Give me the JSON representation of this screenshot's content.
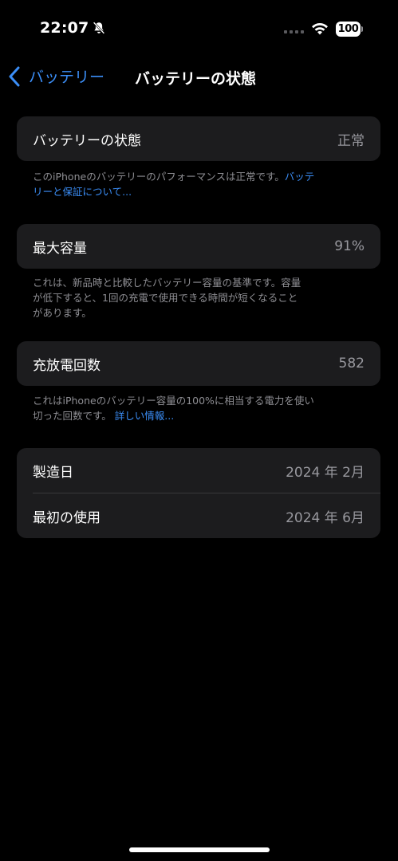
{
  "status_bar": {
    "time": "22:07",
    "battery_level": "100",
    "icons": [
      "bell-slash-icon",
      "signal-icon",
      "wifi-icon",
      "battery-icon"
    ]
  },
  "nav": {
    "back_label": "バッテリー",
    "title": "バッテリーの状態"
  },
  "health": {
    "label": "バッテリーの状態",
    "value": "正常",
    "footer_text": "このiPhoneのバッテリーのパフォーマンスは正常です。",
    "footer_link_part1": "バッテ",
    "footer_link_part2": "リーと保証について..."
  },
  "capacity": {
    "label": "最大容量",
    "value": "91%",
    "footer_line1": "これは、新品時と比較したバッテリー容量の基準です。容量",
    "footer_line2": "が低下すると、1回の充電で使用できる時間が短くなること",
    "footer_line3": "があります。"
  },
  "cycles": {
    "label": "充放電回数",
    "value": "582",
    "footer_line1": "これはiPhoneのバッテリー容量の100%に相当する電力を使い",
    "footer_line2": "切った回数です。",
    "footer_link": "詳しい情報..."
  },
  "dates": {
    "manufacture_label": "製造日",
    "manufacture_value": "2024 年 2月",
    "first_use_label": "最初の使用",
    "first_use_value": "2024 年 6月"
  },
  "colors": {
    "accent": "#3b8ef7",
    "background": "#000000",
    "cell": "#1c1c1e",
    "secondary_text": "#98989e"
  }
}
